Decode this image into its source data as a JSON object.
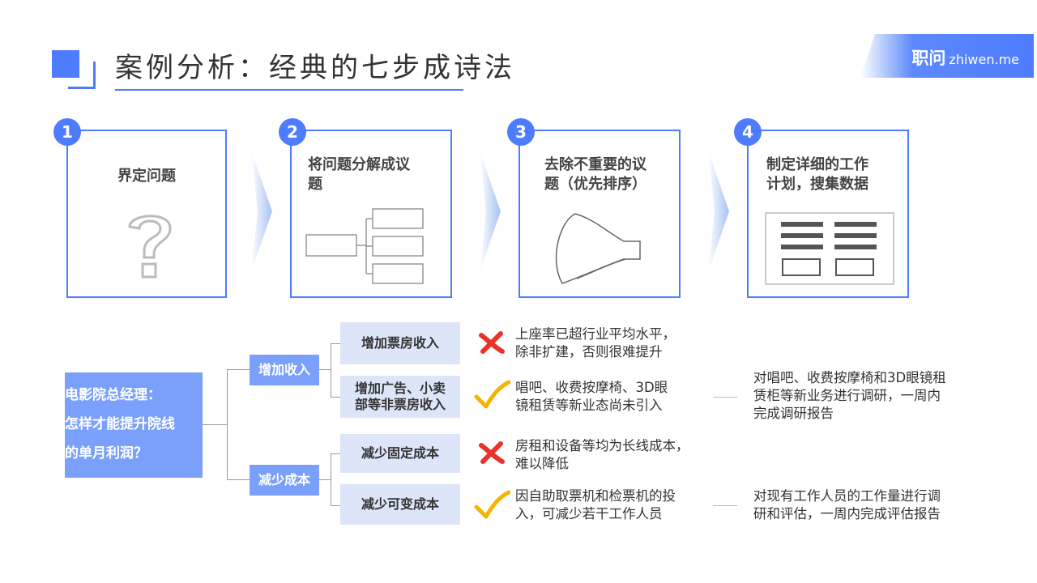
{
  "header": {
    "title": "案例分析：经典的七步成诗法",
    "brand": "职问",
    "brand_domain": "zhiwen.me",
    "accent_color": "#4d7cfe"
  },
  "steps": [
    {
      "number": "1",
      "label": "界定问题",
      "icon": "question-mark-icon"
    },
    {
      "number": "2",
      "label_line1": "将问题分解成议",
      "label_line2": "题",
      "icon": "issue-tree-icon"
    },
    {
      "number": "3",
      "label_line1": "去除不重要的议",
      "label_line2": "题（优先排序）",
      "icon": "funnel-icon"
    },
    {
      "number": "4",
      "label_line1": "制定详细的工作",
      "label_line2": "计划，搜集数据",
      "icon": "work-plan-table-icon"
    }
  ],
  "tree": {
    "root_line1": "电影院总经理：",
    "root_line2": "怎样才能提升院线",
    "root_line3": "的单月利润？",
    "branches": [
      {
        "label": "增加收入"
      },
      {
        "label": "减少成本"
      }
    ],
    "leaves": [
      {
        "label": "增加票房收入",
        "status": "cross-icon",
        "desc_line1": "上座率已超行业平均水平，",
        "desc_line2": "除非扩建，否则很难提升",
        "plan_line1": "",
        "plan_line2": "",
        "plan_line3": ""
      },
      {
        "label_line1": "增加广告、小卖",
        "label_line2": "部等非票房收入",
        "status": "check-icon",
        "desc_line1": "唱吧、收费按摩椅、3D眼",
        "desc_line2": "镜租赁等新业态尚未引入",
        "plan_line1": "对唱吧、收费按摩椅和3D眼镜租",
        "plan_line2": "赁柜等新业务进行调研，一周内",
        "plan_line3": "完成调研报告"
      },
      {
        "label": "减少固定成本",
        "status": "cross-icon",
        "desc_line1": "房租和设备等均为长线成本，",
        "desc_line2": "难以降低"
      },
      {
        "label": "减少可变成本",
        "status": "check-icon",
        "desc_line1": "因自助取票机和检票机的投",
        "desc_line2": "入，可减少若干工作人员",
        "plan_line1": "对现有工作人员的工作量进行调",
        "plan_line2": "研和评估，一周内完成评估报告"
      }
    ]
  },
  "colors": {
    "cross": "#e8332a",
    "check": "#f4b400",
    "box": "#7aa0fc",
    "subbox": "#dce6f8"
  }
}
